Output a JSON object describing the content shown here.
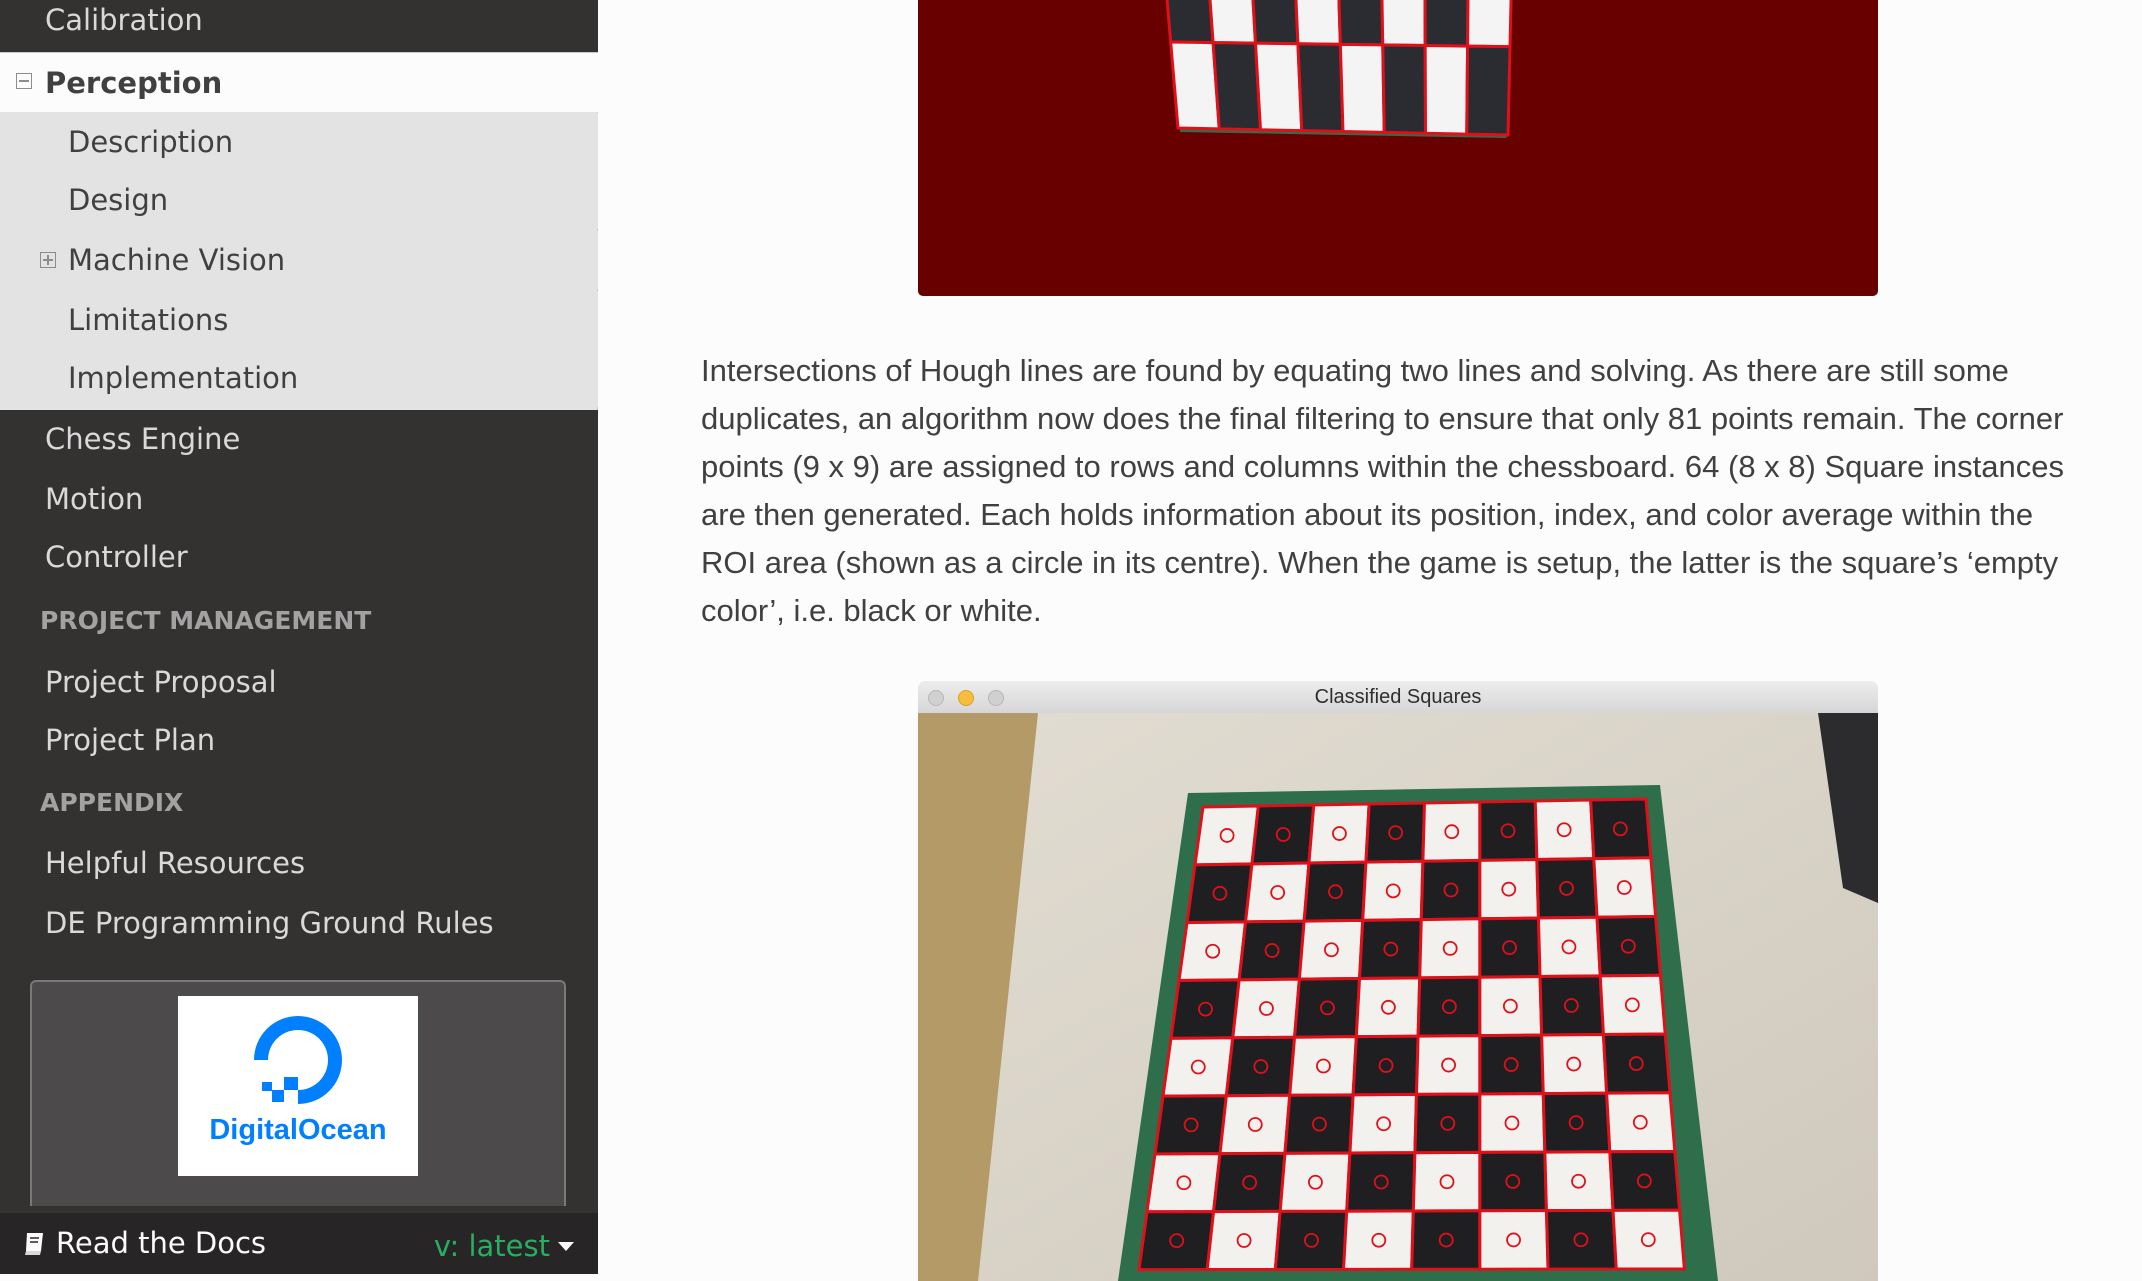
{
  "sidebar": {
    "items_top": [
      {
        "label": "Calibration"
      }
    ],
    "current": {
      "label": "Perception"
    },
    "sub_items": [
      {
        "label": "Description"
      },
      {
        "label": "Design"
      },
      {
        "label": "Machine Vision"
      },
      {
        "label": "Limitations"
      },
      {
        "label": "Implementation"
      }
    ],
    "items_after": [
      {
        "label": "Chess Engine"
      },
      {
        "label": "Motion"
      },
      {
        "label": "Controller"
      }
    ],
    "caption_project": "PROJECT MANAGEMENT",
    "project_items": [
      {
        "label": "Project Proposal"
      },
      {
        "label": "Project Plan"
      }
    ],
    "caption_appendix": "APPENDIX",
    "appendix_items": [
      {
        "label": "Helpful Resources"
      },
      {
        "label": "DE Programming Ground Rules"
      }
    ],
    "sponsor": {
      "name": "DigitalOcean",
      "brand_color": "#0080ff"
    },
    "rtd": {
      "label": "Read the Docs",
      "version": "v: latest",
      "version_color": "#27ae60"
    }
  },
  "main": {
    "paragraph": "Intersections of Hough lines are found by equating two lines and solving. As there are still some duplicates, an algorithm now does the final filtering to ensure that only 81 points remain. The corner points (9 x 9) are assigned to rows and columns within the chessboard. 64 (8 x 8) Square instances are then generated. Each holds information about its position, index, and color average within the ROI area (shown as a circle in its centre). When the game is setup, the latter is the square’s ‘empty color’, i.e. black or white.",
    "figure2_window_title": "Classified Squares"
  },
  "colors": {
    "sidebar_bg": "#343131",
    "accent_red": "#e0101a",
    "board_green": "#2f6e4a"
  }
}
